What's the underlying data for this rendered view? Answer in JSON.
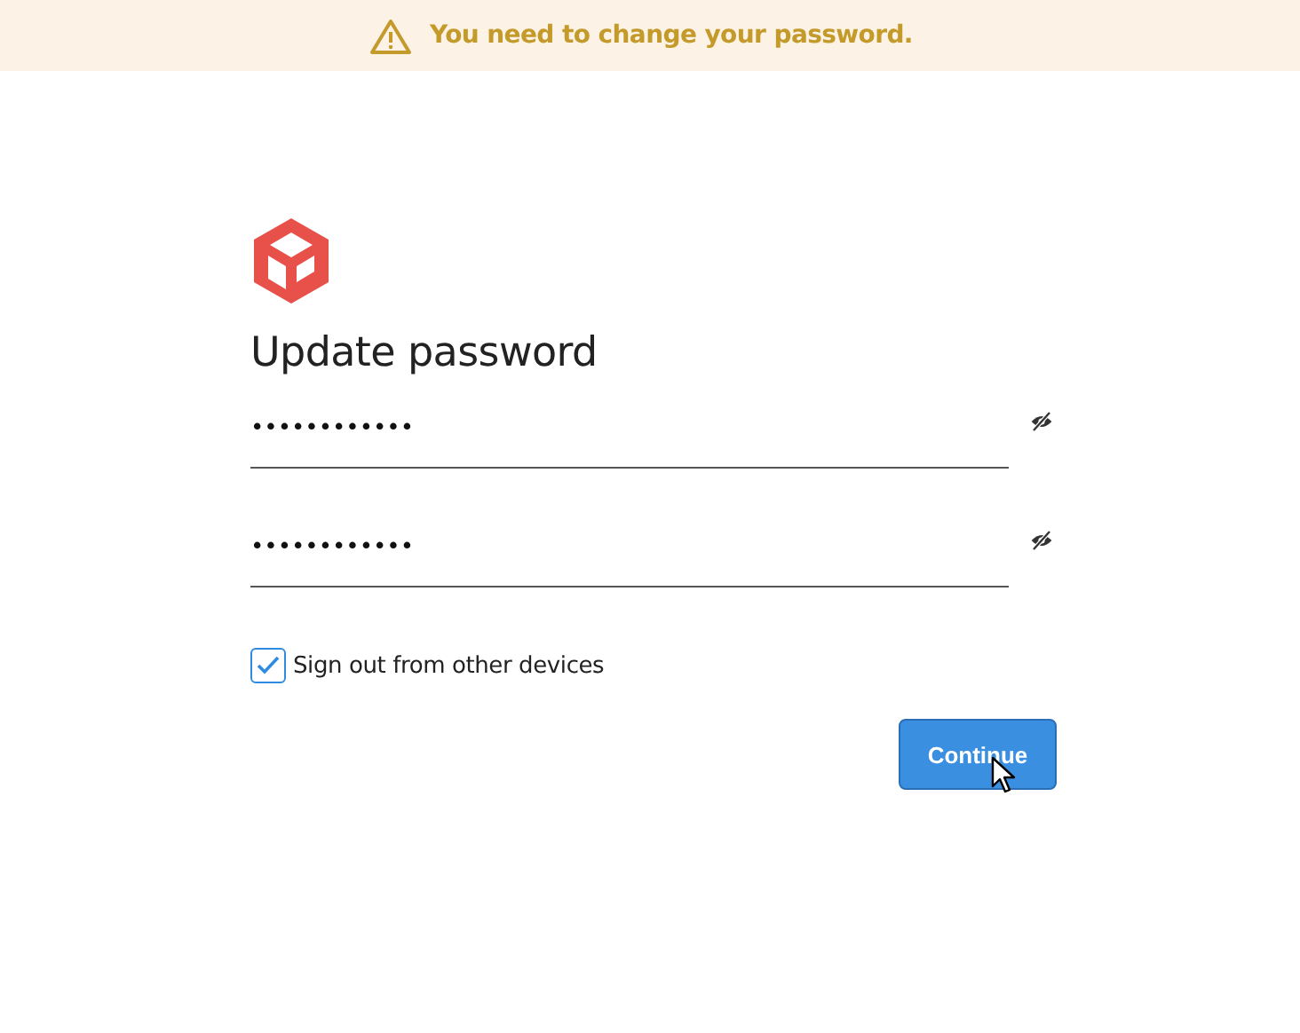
{
  "banner": {
    "message": "You need to change your password."
  },
  "title": "Update password",
  "fields": [
    {
      "value": "••••••••••••",
      "revealed": false
    },
    {
      "value": "••••••••••••",
      "revealed": false
    }
  ],
  "checkbox": {
    "label": "Sign out from other devices",
    "checked": true
  },
  "button": {
    "label": "Continue"
  }
}
